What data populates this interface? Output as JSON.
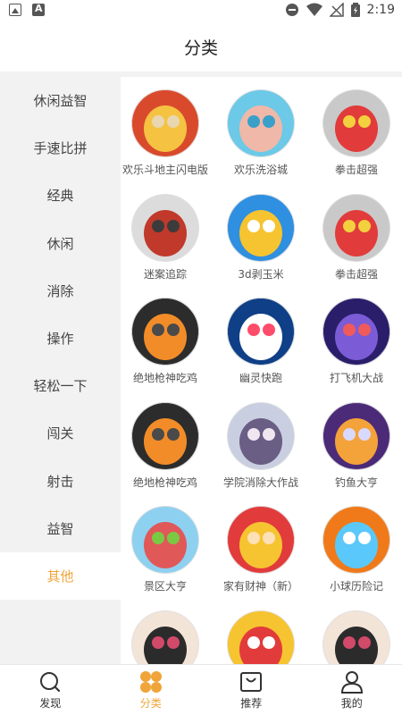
{
  "status_bar": {
    "time": "2:19"
  },
  "header": {
    "title": "分类"
  },
  "sidebar": {
    "items": [
      {
        "label": "休闲益智"
      },
      {
        "label": "手速比拼"
      },
      {
        "label": "经典"
      },
      {
        "label": "休闲"
      },
      {
        "label": "消除"
      },
      {
        "label": "操作"
      },
      {
        "label": "轻松一下"
      },
      {
        "label": "闯关"
      },
      {
        "label": "射击"
      },
      {
        "label": "益智"
      },
      {
        "label": "其他"
      },
      {
        "label": ""
      }
    ],
    "active_index": 10
  },
  "games": [
    {
      "name": "欢乐斗地主闪电版",
      "palette": [
        "#d94a2c",
        "#f5c242",
        "#e8d7b0"
      ]
    },
    {
      "name": "欢乐洗浴城",
      "palette": [
        "#6cc9e8",
        "#f0b8a8",
        "#3aa0c9"
      ]
    },
    {
      "name": "拳击超强",
      "palette": [
        "#c9c9c9",
        "#e23b3b",
        "#f3d03e"
      ]
    },
    {
      "name": "迷案追踪",
      "palette": [
        "#dcdcdc",
        "#c0392b",
        "#3b3b3b"
      ]
    },
    {
      "name": "3d剥玉米",
      "palette": [
        "#2f8fe0",
        "#f6c430",
        "#ffffff"
      ]
    },
    {
      "name": "拳击超强",
      "palette": [
        "#c9c9c9",
        "#e23b3b",
        "#f3d03e"
      ]
    },
    {
      "name": "绝地枪神吃鸡",
      "palette": [
        "#2c2c2c",
        "#f28c28",
        "#4a4a4a"
      ]
    },
    {
      "name": "幽灵快跑",
      "palette": [
        "#0f3f86",
        "#ffffff",
        "#ff4c6a"
      ]
    },
    {
      "name": "打飞机大战",
      "palette": [
        "#2a1e6b",
        "#7b5cd6",
        "#f05a5a"
      ]
    },
    {
      "name": "绝地枪神吃鸡",
      "palette": [
        "#2c2c2c",
        "#f28c28",
        "#4a4a4a"
      ]
    },
    {
      "name": "学院消除大作战",
      "palette": [
        "#c9cfe0",
        "#6a5e85",
        "#f0e6f0"
      ]
    },
    {
      "name": "钓鱼大亨",
      "palette": [
        "#4b2a78",
        "#f4a23a",
        "#d9d9ff"
      ]
    },
    {
      "name": "景区大亨",
      "palette": [
        "#8ed0f0",
        "#e05858",
        "#7ac943"
      ]
    },
    {
      "name": "家有财神（新）",
      "palette": [
        "#e23b3b",
        "#f6c430",
        "#fde0b5"
      ]
    },
    {
      "name": "小球历险记",
      "palette": [
        "#f07a1a",
        "#5ac8fa",
        "#ffffff"
      ]
    },
    {
      "name": "",
      "palette": [
        "#f3e4d8",
        "#2b2b2b",
        "#d24a6a"
      ]
    },
    {
      "name": "",
      "palette": [
        "#f6c430",
        "#e23b3b",
        "#ffffff"
      ]
    },
    {
      "name": "",
      "palette": [
        "#f3e4d8",
        "#2b2b2b",
        "#d24a6a"
      ]
    }
  ],
  "bottom_nav": {
    "items": [
      {
        "label": "发现",
        "icon": "search-icon"
      },
      {
        "label": "分类",
        "icon": "category-icon"
      },
      {
        "label": "推荐",
        "icon": "bag-icon"
      },
      {
        "label": "我的",
        "icon": "user-icon"
      }
    ],
    "active_index": 1
  },
  "colors": {
    "accent": "#f0a53a",
    "sidebar_bg": "#f2f2f2"
  }
}
